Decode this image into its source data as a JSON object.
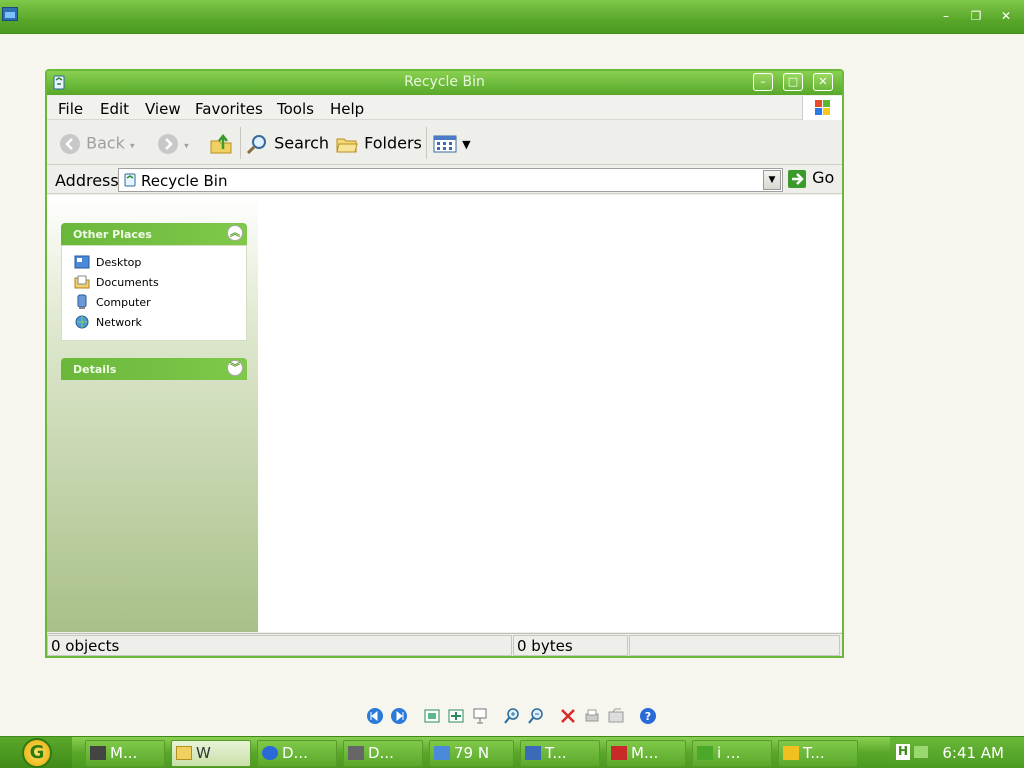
{
  "outer_window": {
    "controls": {
      "minimize": "–",
      "restore": "❐",
      "close": "✕"
    }
  },
  "window": {
    "title": "Recycle Bin",
    "controls": {
      "minimize": "–",
      "maximize": "□",
      "close": "✕"
    }
  },
  "menu": {
    "items": [
      "File",
      "Edit",
      "View",
      "Favorites",
      "Tools",
      "Help"
    ]
  },
  "toolbar": {
    "back_label": "Back",
    "search_label": "Search",
    "folders_label": "Folders"
  },
  "address": {
    "label": "Address",
    "value": "Recycle Bin",
    "go_label": "Go"
  },
  "sidebar": {
    "other_places": {
      "title": "Other Places",
      "items": [
        {
          "label": "Desktop",
          "icon": "desktop-icon"
        },
        {
          "label": "Documents",
          "icon": "documents-folder-icon"
        },
        {
          "label": "Computer",
          "icon": "computer-icon"
        },
        {
          "label": "Network",
          "icon": "network-icon"
        }
      ]
    },
    "details": {
      "title": "Details"
    }
  },
  "status": {
    "objects": "0 objects",
    "size": "0 bytes"
  },
  "taskbar": {
    "tasks": [
      "M...",
      "W",
      "D...",
      "D...",
      "79 N",
      "T...",
      "M...",
      "i ...",
      "T..."
    ],
    "clock": "6:41 AM"
  },
  "colors": {
    "accent": "#6ab83a",
    "title_text": "#e8f6da",
    "pane_bottom": "#a8c088"
  }
}
